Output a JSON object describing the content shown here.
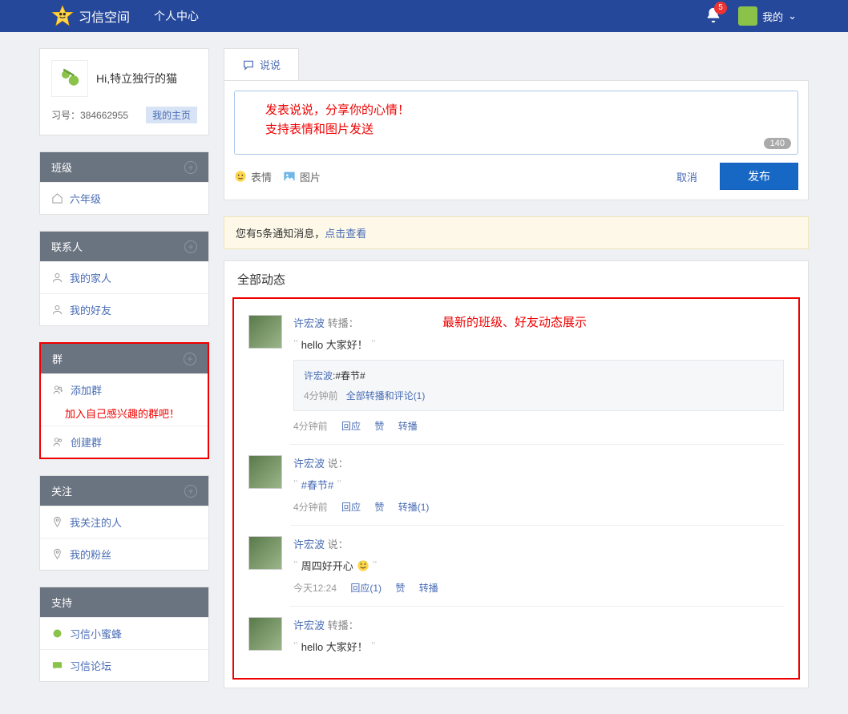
{
  "top": {
    "brand": "习信空间",
    "nav_center": "个人中心",
    "badge": "5",
    "my": "我的",
    "chev": "⌄"
  },
  "profile": {
    "greeting": "Hi,特立独行的猫",
    "id_label": "习号：",
    "id": "384662955",
    "homepage": "我的主页"
  },
  "sections": {
    "class": {
      "title": "班级",
      "items": [
        "六年级"
      ]
    },
    "contacts": {
      "title": "联系人",
      "items": [
        "我的家人",
        "我的好友"
      ]
    },
    "groups": {
      "title": "群",
      "items": [
        "添加群",
        "创建群"
      ],
      "ann": "加入自己感兴趣的群吧！"
    },
    "follow": {
      "title": "关注",
      "items": [
        "我关注的人",
        "我的粉丝"
      ]
    },
    "support": {
      "title": "支持",
      "items": [
        "习信小蜜蜂",
        "习信论坛"
      ]
    }
  },
  "compose": {
    "tab": "说说",
    "ann1": "发表说说，分享你的心情！",
    "ann2": "支持表情和图片发送",
    "count": "140",
    "emoji": "表情",
    "image": "图片",
    "cancel": "取消",
    "publish": "发布"
  },
  "notice": {
    "text": "您有5条通知消息，",
    "link": "点击查看"
  },
  "feed": {
    "title": "全部动态",
    "ann": "最新的班级、好友动态展示",
    "posts": [
      {
        "user": "许宏波",
        "act": "转播：",
        "content": "hello 大家好！",
        "nested": {
          "user": "许宏波",
          "text": ":#春节#",
          "time": "4分钟前",
          "link": "全部转播和评论(1)"
        },
        "time": "4分钟前",
        "actions": [
          "回应",
          "赞",
          "转播"
        ]
      },
      {
        "user": "许宏波",
        "act": "说：",
        "content_topic": "#春节#",
        "time": "4分钟前",
        "actions": [
          "回应",
          "赞",
          "转播(1)"
        ]
      },
      {
        "user": "许宏波",
        "act": "说：",
        "content": "周四好开心",
        "emoji": true,
        "time": "今天12:24",
        "actions": [
          "回应(1)",
          "赞",
          "转播"
        ]
      },
      {
        "user": "许宏波",
        "act": "转播：",
        "content": "hello 大家好！"
      }
    ]
  }
}
